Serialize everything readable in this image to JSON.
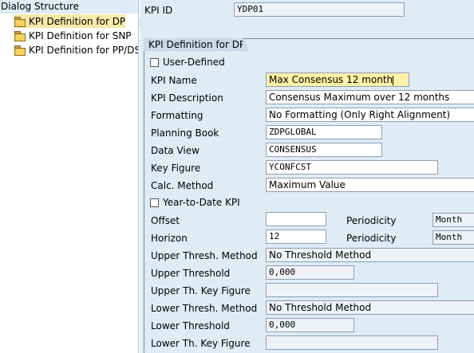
{
  "tree": {
    "title": "Dialog Structure",
    "items": [
      {
        "label": "KPI Definition for DP",
        "selected": true
      },
      {
        "label": "KPI Definition for SNP",
        "selected": false
      },
      {
        "label": "KPI Definition for PP/DS",
        "selected": false
      }
    ]
  },
  "header": {
    "kpi_id_label": "KPI ID",
    "kpi_id_value": "YDP01"
  },
  "panel": {
    "title": "KPI Definition for DP",
    "user_defined_label": "User-Defined",
    "kpi_name_label": "KPI Name",
    "kpi_name_value": "Max Consensus 12 month",
    "kpi_description_label": "KPI Description",
    "kpi_description_value": "Consensus Maximum over 12 months",
    "formatting_label": "Formatting",
    "formatting_value": "No Formatting (Only Right Alignment)",
    "planning_book_label": "Planning Book",
    "planning_book_value": "ZDPGLOBAL",
    "data_view_label": "Data View",
    "data_view_value": "CONSENSUS",
    "key_figure_label": "Key Figure",
    "key_figure_value": "YCONFCST",
    "calc_method_label": "Calc. Method",
    "calc_method_value": "Maximum Value",
    "ytd_label": "Year-to-Date KPI",
    "offset_label": "Offset",
    "offset_value": "",
    "periodicity_label": "Periodicity",
    "offset_periodicity_value": "Month",
    "horizon_label": "Horizon",
    "horizon_value": "12",
    "horizon_periodicity_value": "Month",
    "upper_method_label": "Upper Thresh. Method",
    "upper_method_value": "No Threshold Method",
    "upper_threshold_label": "Upper Threshold",
    "upper_threshold_value": "0,000",
    "upper_key_figure_label": "Upper Th. Key Figure",
    "upper_key_figure_value": "",
    "lower_method_label": "Lower Thresh. Method",
    "lower_method_value": "No Threshold Method",
    "lower_threshold_label": "Lower Threshold",
    "lower_threshold_value": "0,000",
    "lower_key_figure_label": "Lower Th. Key Figure",
    "lower_key_figure_value": ""
  },
  "colors": {
    "background": "#dfebf5",
    "selection": "#f7e9a8",
    "focus_field": "#fff1a6"
  }
}
